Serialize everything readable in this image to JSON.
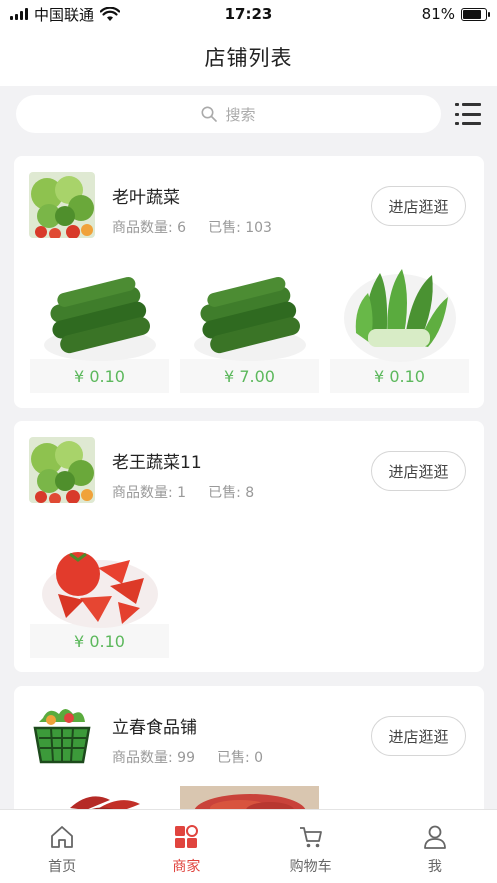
{
  "status_bar": {
    "carrier": "中国联通",
    "time": "17:23",
    "battery": "81%",
    "battery_level": 0.81
  },
  "header": {
    "title": "店铺列表"
  },
  "search": {
    "placeholder": "搜索"
  },
  "shops": [
    {
      "name": "老叶蔬菜",
      "goods_count": "商品数量: 6",
      "sold": "已售: 103",
      "button": "进店逛逛",
      "products": [
        {
          "price": "¥ 0.10",
          "image": "cucumber"
        },
        {
          "price": "¥ 7.00",
          "image": "cucumber"
        },
        {
          "price": "¥ 0.10",
          "image": "bok-choy"
        }
      ]
    },
    {
      "name": "老王蔬菜11",
      "goods_count": "商品数量: 1",
      "sold": "已售: 8",
      "button": "进店逛逛",
      "products": [
        {
          "price": "¥ 0.10",
          "image": "tomato"
        }
      ]
    },
    {
      "name": "立春食品铺",
      "goods_count": "商品数量: 99",
      "sold": "已售: 0",
      "button": "进店逛逛",
      "products": [
        {
          "image": "chili"
        },
        {
          "image": "goji"
        }
      ]
    }
  ],
  "tabs": [
    {
      "label": "首页",
      "icon": "home-icon",
      "active": false
    },
    {
      "label": "商家",
      "icon": "shop-icon",
      "active": true
    },
    {
      "label": "购物车",
      "icon": "cart-icon",
      "active": false
    },
    {
      "label": "我",
      "icon": "user-icon",
      "active": false
    }
  ],
  "colors": {
    "accent": "#e0443e",
    "price": "#5cb85c"
  }
}
